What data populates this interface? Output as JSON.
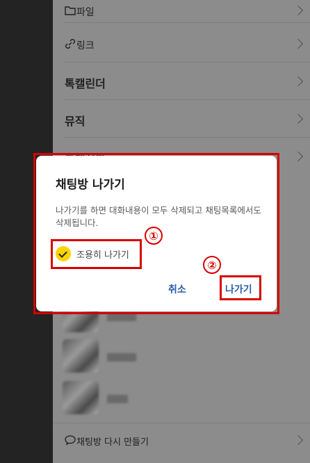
{
  "drawer": {
    "items": [
      {
        "label": "파일",
        "icon": "folder-icon",
        "bold": false
      },
      {
        "label": "링크",
        "icon": "link-icon",
        "bold": false
      },
      {
        "label": "톡캘린더",
        "icon": "",
        "bold": true
      },
      {
        "label": "뮤직",
        "icon": "",
        "bold": true
      },
      {
        "label": "톡게시판",
        "icon": "",
        "bold": true
      }
    ],
    "bottom_item": {
      "label": "채팅방 다시 만들기",
      "icon": "speech-bubble-icon"
    }
  },
  "dialog": {
    "title": "채팅방 나가기",
    "message": "나가기를 하면 대화내용이 모두 삭제되고 채팅목록에서도 삭제됩니다.",
    "quiet_leave_label": "조용히 나가기",
    "quiet_leave_checked": true,
    "cancel_label": "취소",
    "leave_label": "나가기"
  },
  "annotations": [
    "①",
    "②"
  ],
  "colors": {
    "accent_yellow": "#fcd400",
    "annotation_red": "#d60000",
    "button_blue": "#2b5fa8"
  }
}
